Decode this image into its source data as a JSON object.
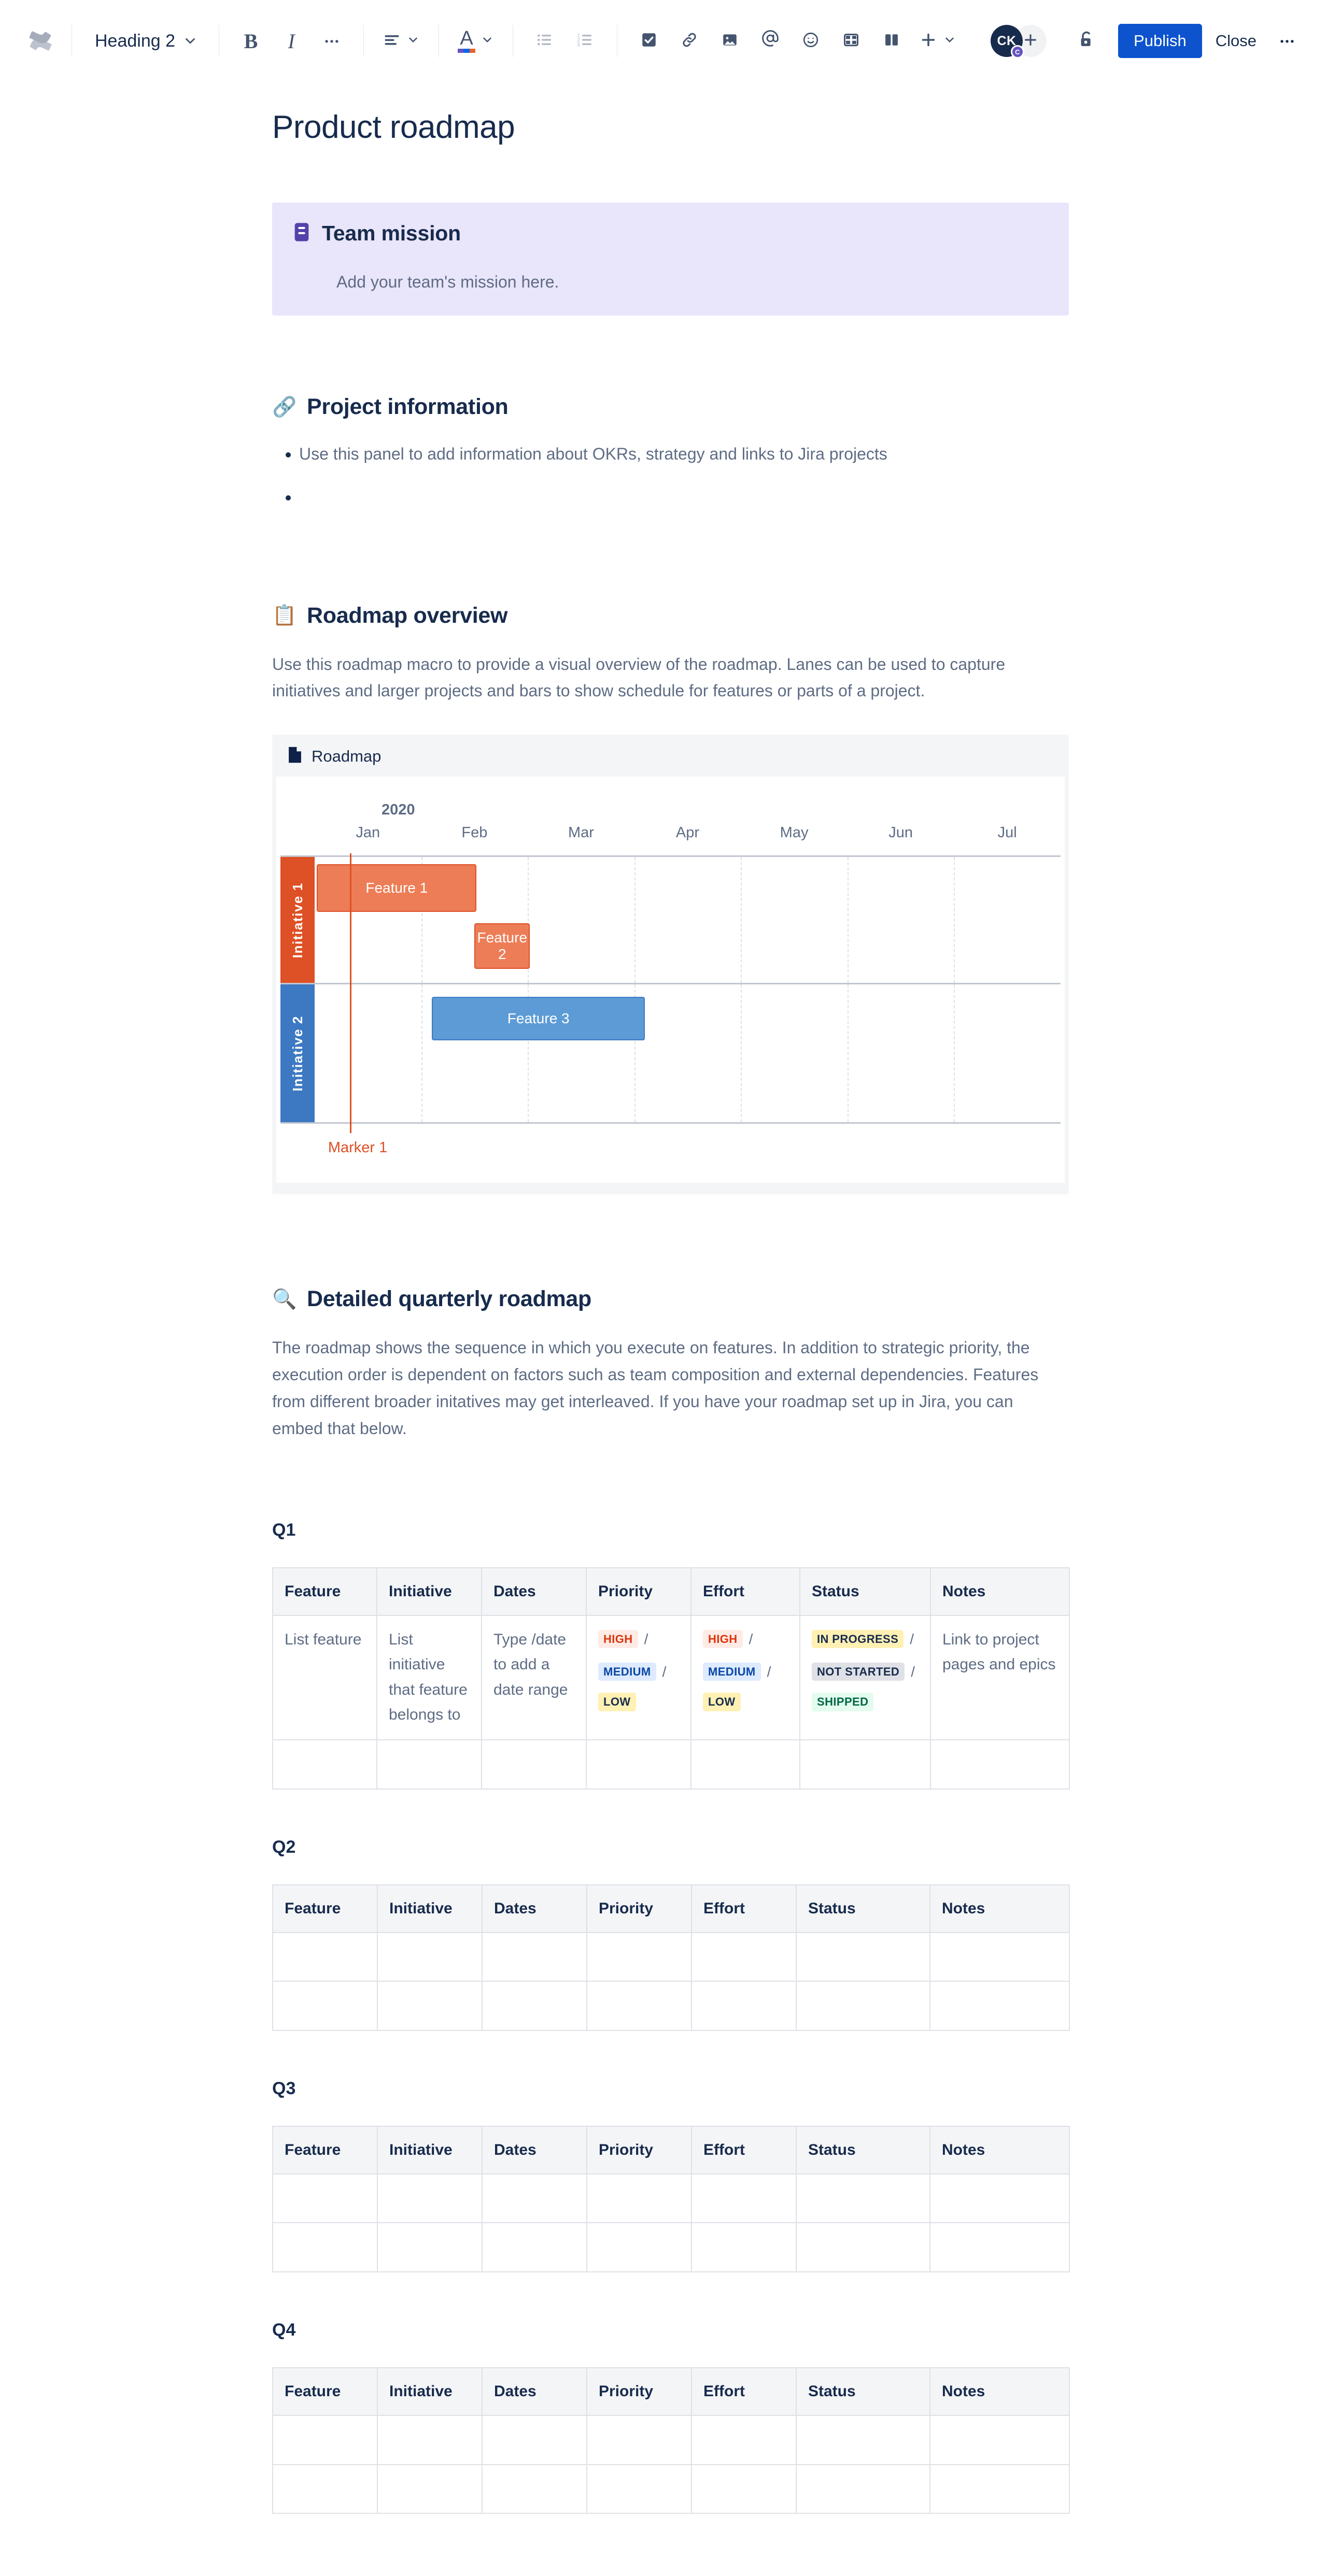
{
  "toolbar": {
    "logo_icon": "confluence-logo",
    "text_style": {
      "label": "Heading 2",
      "chevron": "chevron-down-icon"
    },
    "bold": "B",
    "italic": "I",
    "more_formatting": "…",
    "align_icon": "text-align-icon",
    "text_color_letter": "A",
    "bullet_list_icon": "bullet-list-icon",
    "numbered_list_icon": "numbered-list-icon",
    "task_icon": "checkbox-icon",
    "link_icon": "link-icon",
    "image_icon": "image-icon",
    "mention_icon": "mention-at-icon",
    "emoji_icon": "emoji-smiley-icon",
    "table_icon": "table-icon",
    "layout_icon": "page-layout-icon",
    "insert_icon": "plus-icon",
    "avatar_initials": "CK",
    "avatar_badge": "C",
    "add_person_icon": "plus-icon",
    "restrictions_icon": "unlocked-padlock-icon",
    "publish_label": "Publish",
    "close_label": "Close",
    "overflow_label": "…",
    "accent_color": "#0C53CD"
  },
  "document": {
    "title": "Product roadmap"
  },
  "team_mission_panel": {
    "icon": "note-panel-icon",
    "title": "Team mission",
    "body": "Add your team's mission here."
  },
  "project_information": {
    "emoji": "🔗",
    "heading": "Project information",
    "bullets": [
      "Use this panel to add information about OKRs, strategy and links to Jira projects",
      ""
    ]
  },
  "roadmap_overview": {
    "emoji": "📋",
    "heading": "Roadmap overview",
    "paragraph": "Use this roadmap macro to provide a visual overview of the roadmap. Lanes can be used to capture initiatives and larger projects and bars to show schedule for features or parts of a project.",
    "macro": {
      "icon": "page-icon",
      "title": "Roadmap"
    }
  },
  "chart_data": {
    "type": "bar",
    "title": "Roadmap",
    "subtitle": "",
    "orientation": "horizontal-gantt",
    "year": "2020",
    "categories": [
      "Jan",
      "Feb",
      "Mar",
      "Apr",
      "May",
      "Jun",
      "Jul"
    ],
    "xlabel": "",
    "ylabel": "",
    "grid": true,
    "legend": "none",
    "lanes": [
      {
        "name": "Initiative 1",
        "color": "#DE5025"
      },
      {
        "name": "Initiative 2",
        "color": "#3D79C2"
      }
    ],
    "bars": [
      {
        "label": "Feature 1",
        "lane": "Initiative 1",
        "start_month": "Jan",
        "end_month": "Feb",
        "start_fraction": 0.02,
        "end_fraction": 1.52,
        "color": "#ED7D56"
      },
      {
        "label": "Feature 2",
        "lane": "Initiative 1",
        "start_month": "Feb",
        "end_month": "Mar",
        "start_fraction": 1.5,
        "end_fraction": 2.02,
        "color": "#ED7D56"
      },
      {
        "label": "Feature 3",
        "lane": "Initiative 2",
        "start_month": "Feb",
        "end_month": "Apr",
        "start_fraction": 1.1,
        "end_fraction": 3.1,
        "color": "#5C9BD5"
      }
    ],
    "markers": [
      {
        "label": "Marker 1",
        "month": "Jan",
        "fraction": 0.33,
        "color": "#DE5025"
      }
    ],
    "axis_ranges": {
      "x": [
        "Jan 2020",
        "Jul 2020"
      ]
    }
  },
  "detailed_roadmap": {
    "emoji": "🔍",
    "heading": "Detailed quarterly roadmap",
    "paragraph": "The roadmap shows the sequence in which you execute on features. In addition to strategic priority, the execution order is dependent on factors such as team composition and external dependencies. Features from different broader initatives may get interleaved. If you have your roadmap set up in Jira, you can embed that below."
  },
  "table_columns": [
    "Feature",
    "Initiative",
    "Dates",
    "Priority",
    "Effort",
    "Status",
    "Notes"
  ],
  "quarters": [
    {
      "label": "Q1",
      "first_row": {
        "feature": "List feature",
        "initiative": "List initiative that feature belongs to",
        "dates": "Type /date to add a date range",
        "priority": [
          {
            "text": "HIGH",
            "style": "loz-red",
            "sep": "/"
          },
          {
            "text": "MEDIUM",
            "style": "loz-blue",
            "sep": "/"
          },
          {
            "text": "LOW",
            "style": "loz-yellow",
            "sep": ""
          }
        ],
        "effort": [
          {
            "text": "HIGH",
            "style": "loz-red",
            "sep": "/"
          },
          {
            "text": "MEDIUM",
            "style": "loz-blue",
            "sep": "/"
          },
          {
            "text": "LOW",
            "style": "loz-yellow",
            "sep": ""
          }
        ],
        "status": [
          {
            "text": "IN PROGRESS",
            "style": "loz-yellow",
            "sep": "/"
          },
          {
            "text": "NOT STARTED",
            "style": "loz-grey",
            "sep": "/"
          },
          {
            "text": "SHIPPED",
            "style": "loz-green",
            "sep": ""
          }
        ],
        "notes": "Link to project pages and epics"
      },
      "empty_rows": 1
    },
    {
      "label": "Q2",
      "first_row": null,
      "empty_rows": 2
    },
    {
      "label": "Q3",
      "first_row": null,
      "empty_rows": 2
    },
    {
      "label": "Q4",
      "first_row": null,
      "empty_rows": 2
    }
  ]
}
